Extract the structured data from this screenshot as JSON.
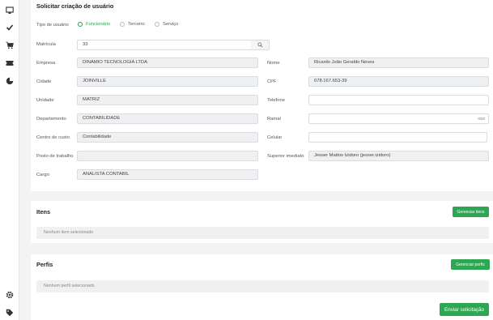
{
  "sidebar": {
    "icons": [
      "monitor-icon",
      "check-icon",
      "cart-icon",
      "ticket-icon",
      "pie-chart-icon",
      "gear-icon",
      "tag-icon"
    ]
  },
  "form": {
    "title": "Solicitar criação de usuário",
    "user_type_label": "Tipo de usuário",
    "user_types": [
      "Funcionário",
      "Terceiro",
      "Serviço"
    ],
    "selected_type": "Funcionário",
    "matricula_label": "Matrícula",
    "matricula_value": "33",
    "empresa_label": "Empresa",
    "empresa_value": "DINAMIO TECNOLOGIA LTDA",
    "cidade_label": "Cidade",
    "cidade_value": "JOINVILLE",
    "unidade_label": "Unidade",
    "unidade_value": "MATRIZ",
    "departamento_label": "Departamento",
    "departamento_value": "CONTABILIDADE",
    "centro_label": "Centro de custo",
    "centro_value": "Contabilidade",
    "posto_label": "Posto de trabalho",
    "posto_value": "",
    "cargo_label": "Cargo",
    "cargo_value": "ANALISTA CONTABIL",
    "nome_label": "Nome",
    "nome_value": "Ricardo João Geraldo Neves",
    "cpf_label": "CPF",
    "cpf_value": "078.167.653-39",
    "telefone_label": "Telefone",
    "telefone_value": "",
    "ramal_label": "Ramal",
    "ramal_value": "",
    "ramal_counter": "0/20",
    "celular_label": "Celular",
    "celular_value": "",
    "superior_label": "Superior imediato",
    "superior_value": "Jesser Mattos Izidoro (jesser.izidoro)"
  },
  "itens": {
    "title": "Itens",
    "button": "Gerenciar itens",
    "empty": "Nenhum item selecionado"
  },
  "perfis": {
    "title": "Perfis",
    "button": "Gerenciar perfis",
    "empty": "Nenhum perfil selecionado"
  },
  "submit": {
    "label": "Enviar solicitação"
  },
  "colors": {
    "accent": "#2fa654",
    "field_bg": "#eef0f2"
  }
}
